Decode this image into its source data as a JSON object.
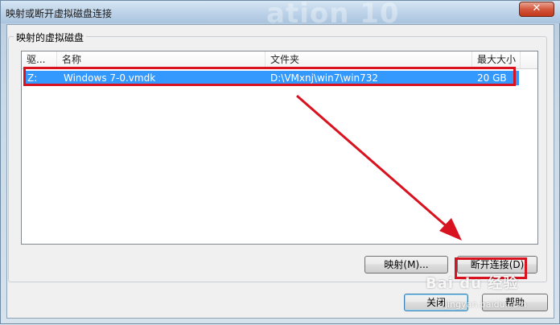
{
  "window": {
    "title": "映射或断开虚拟磁盘连接",
    "background_text": "ation 10",
    "close_label": "✕"
  },
  "group": {
    "label": "映射的虚拟磁盘"
  },
  "list": {
    "columns": [
      "驱...",
      "名称",
      "文件夹",
      "最大大小"
    ],
    "rows": [
      {
        "drive": "Z:",
        "name": "Windows 7-0.vmdk",
        "folder": "D:\\VMxnj\\win7\\win732",
        "size": "20 GB",
        "selected": true
      }
    ]
  },
  "buttons": {
    "map": "映射(M)...",
    "disconnect": "断开连接(D)",
    "close": "关闭",
    "help": "帮助"
  },
  "watermark": {
    "brand": "Bai du 经验",
    "url": "jingyan.baidu.com"
  },
  "colors": {
    "selection": "#3399ff",
    "annotation": "#d9121f"
  }
}
